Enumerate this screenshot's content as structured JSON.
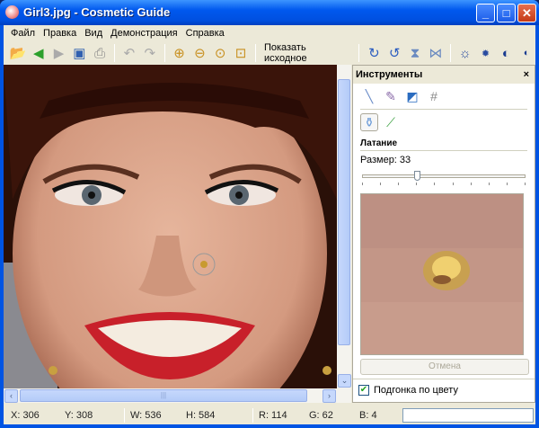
{
  "window": {
    "title": "Girl3.jpg - Cosmetic Guide"
  },
  "menu": [
    "Файл",
    "Правка",
    "Вид",
    "Демонстрация",
    "Справка"
  ],
  "toolbar": {
    "show_original": "Показать исходное"
  },
  "panel": {
    "title": "Инструменты",
    "close": "×",
    "section": "Латание",
    "size_label": "Размер: 33",
    "size_value": 33,
    "size_max": 100,
    "cancel": "Отмена",
    "color_fit": "Подгонка по цвету",
    "color_fit_checked": true
  },
  "status": {
    "x": "X: 306",
    "y": "Y: 308",
    "w": "W: 536",
    "h": "H: 584",
    "r": "R: 114",
    "g": "G: 62",
    "b": "B: 4"
  },
  "colors": {
    "titlebar": "#0058ee",
    "face": "#d9a58c",
    "lips": "#c8202a"
  }
}
